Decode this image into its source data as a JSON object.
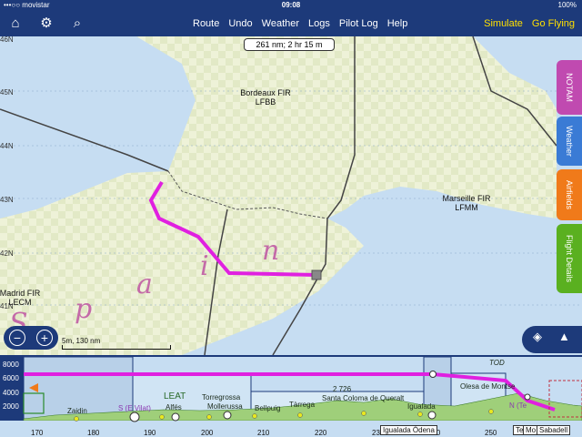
{
  "status": {
    "carrier": "•••○○ movistar",
    "time": "09:08",
    "battery": "100%"
  },
  "toolbar": {
    "menu": [
      "Route",
      "Undo",
      "Weather",
      "Logs",
      "Pilot Log",
      "Help"
    ],
    "simulate": "Simulate",
    "go_flying": "Go Flying",
    "icons": [
      "home-icon",
      "gear-icon",
      "search-icon"
    ]
  },
  "map": {
    "distance_time": "261 nm; 2 hr 15 m",
    "latitudes": [
      "46N",
      "45N",
      "44N",
      "43N",
      "42N",
      "41N"
    ],
    "firs": [
      {
        "name": "Bordeaux FIR",
        "code": "LFBB"
      },
      {
        "name": "Marseille FIR",
        "code": "LFMM"
      },
      {
        "name": "Madrid FIR",
        "code": "LECM"
      }
    ],
    "country_letters": [
      "S",
      "p",
      "a",
      "i",
      "n"
    ],
    "scale": "5m, 130 nm",
    "controls": {
      "zoom_out": "−",
      "zoom_in": "+",
      "layers_icon": "layers-icon",
      "north_icon": "north-arrow-icon"
    }
  },
  "side_tabs": [
    {
      "label": "NOTAM",
      "color": "#c04ab0"
    },
    {
      "label": "Weather",
      "color": "#3a7bd5"
    },
    {
      "label": "Airfields",
      "color": "#f07a1a"
    },
    {
      "label": "Flight Details",
      "color": "#5ab020"
    }
  ],
  "profile": {
    "altitudes": [
      "8000",
      "6000",
      "4000",
      "2000"
    ],
    "labels": {
      "tod": "TOD",
      "leat": "LEAT",
      "zaidin": "Zaidin",
      "s_east": "S (E Vilat)",
      "alfes": "Alfés",
      "torregrossa": "Torregrossa",
      "mollerussa": "Mollerussa",
      "bellpuig": "Bellpuig",
      "tarrega": "Tàrrega",
      "elev": "2 726",
      "santa_coloma": "Santa Coloma de Queralt",
      "igualada": "Igualada",
      "olesa": "Olesa de Montse",
      "n_te": "N (Te"
    },
    "axis": [
      "170",
      "180",
      "190",
      "200",
      "210",
      "220",
      "230",
      "240",
      "250"
    ],
    "boxes": [
      "Igualada Ódena",
      "Te",
      "Mo",
      "Sabadell"
    ]
  },
  "colors": {
    "toolbar": "#1d3a7a",
    "route": "#e020e0",
    "sea": "#c6ddf2",
    "land": "#ecf0d4",
    "accent": "#ffe000"
  }
}
